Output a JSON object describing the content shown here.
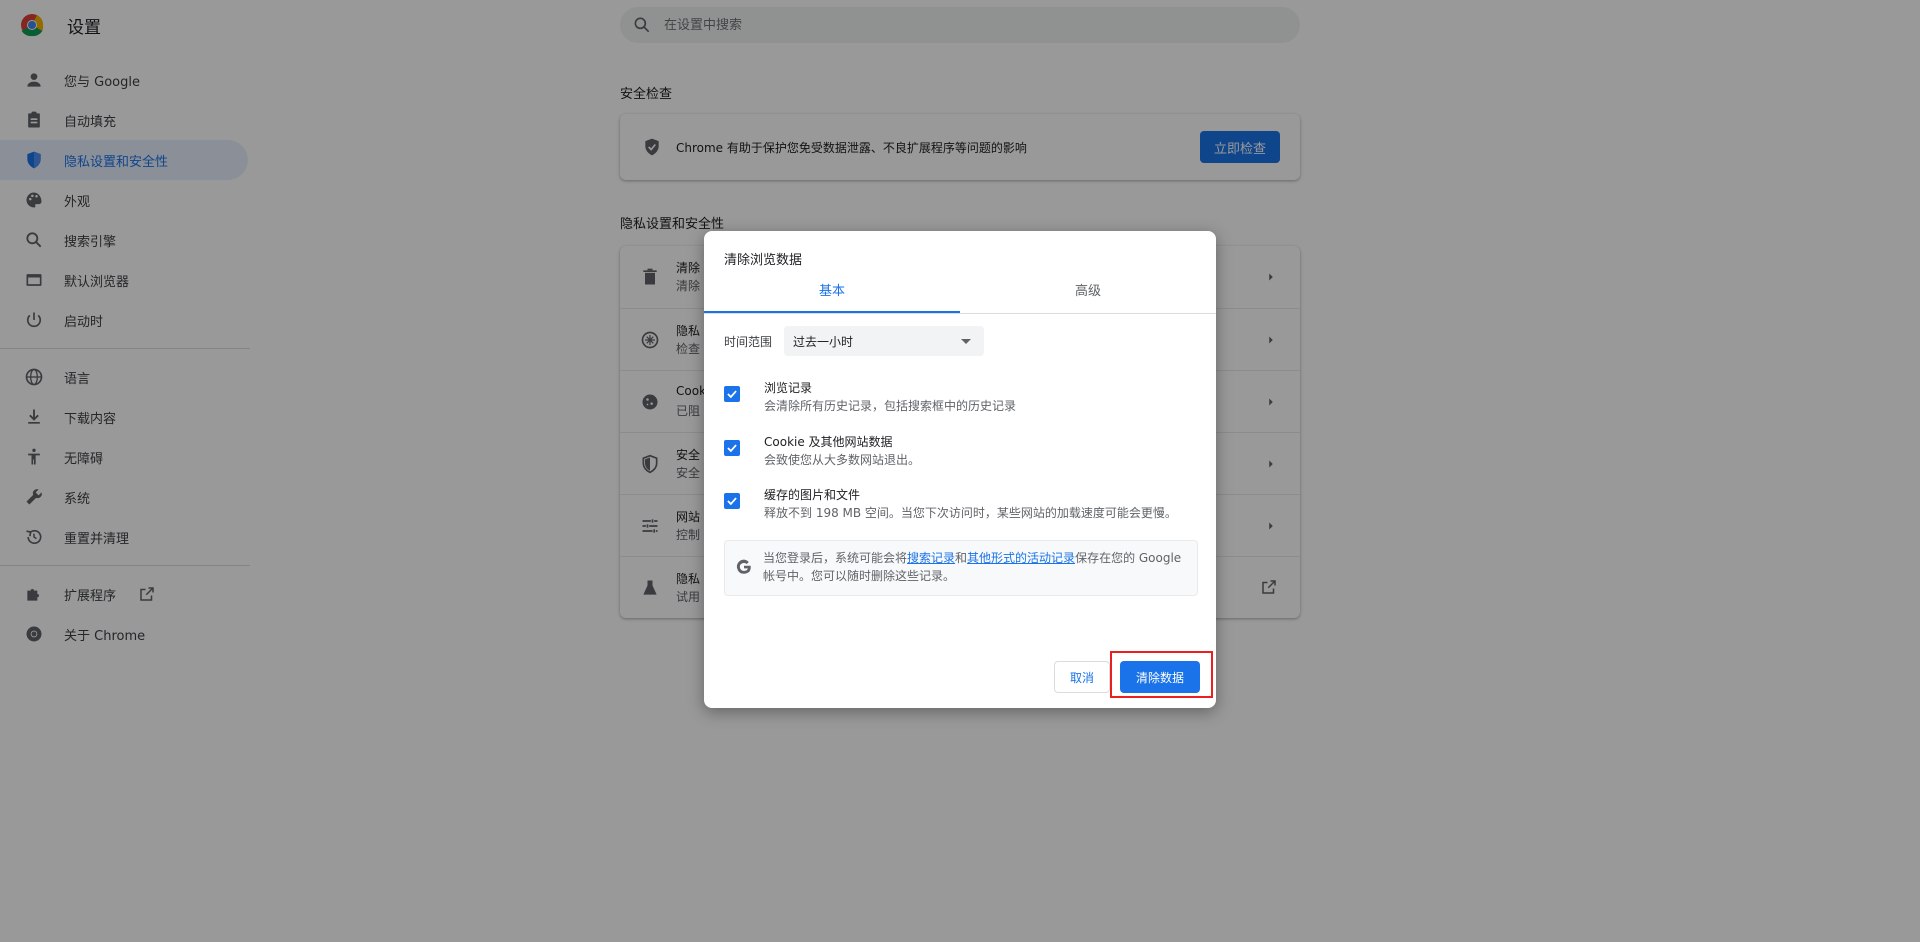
{
  "app": {
    "title": "设置",
    "icon": "chrome-logo"
  },
  "search": {
    "placeholder": "在设置中搜索",
    "value": "",
    "icon": "search-icon"
  },
  "sidebar": {
    "items": [
      {
        "label": "您与 Google",
        "icon": "person-icon",
        "active": false
      },
      {
        "label": "自动填充",
        "icon": "clipboard-icon",
        "active": false
      },
      {
        "label": "隐私设置和安全性",
        "icon": "shield-icon",
        "active": true
      },
      {
        "label": "外观",
        "icon": "palette-icon",
        "active": false
      },
      {
        "label": "搜索引擎",
        "icon": "search-icon",
        "active": false
      },
      {
        "label": "默认浏览器",
        "icon": "browser-icon",
        "active": false
      },
      {
        "label": "启动时",
        "icon": "power-icon",
        "active": false
      },
      {
        "label": "语言",
        "icon": "globe-icon",
        "active": false
      },
      {
        "label": "下载内容",
        "icon": "download-icon",
        "active": false
      },
      {
        "label": "无障碍",
        "icon": "accessibility-icon",
        "active": false
      },
      {
        "label": "系统",
        "icon": "wrench-icon",
        "active": false
      },
      {
        "label": "重置并清理",
        "icon": "restore-icon",
        "active": false
      },
      {
        "label": "扩展程序",
        "icon": "puzzle-icon",
        "active": false
      },
      {
        "label": "关于 Chrome",
        "icon": "chrome-icon",
        "active": false
      }
    ]
  },
  "safety_check": {
    "section_title": "安全检查",
    "text": "Chrome 有助于保护您免受数据泄露、不良扩展程序等问题的影响",
    "button": "立即检查"
  },
  "privacy": {
    "section_title": "隐私设置和安全性",
    "rows": [
      {
        "title": "清除",
        "subtitle": "清除",
        "icon": "trash-icon"
      },
      {
        "title": "隐私",
        "subtitle": "检查",
        "icon": "privacy-guide-icon"
      },
      {
        "title": "Cook",
        "subtitle": "已阻",
        "icon": "cookie-icon"
      },
      {
        "title": "安全",
        "subtitle": "安全",
        "icon": "security-shield-icon"
      },
      {
        "title": "网站",
        "subtitle": "控制",
        "icon": "tune-icon"
      },
      {
        "title": "隐私",
        "subtitle": "试用",
        "icon": "flask-icon"
      }
    ]
  },
  "dialog": {
    "title": "清除浏览数据",
    "tabs": [
      "基本",
      "高级"
    ],
    "active_tab": "基本",
    "time_range_label": "时间范围",
    "time_range_value": "过去一小时",
    "options": [
      {
        "title": "浏览记录",
        "subtitle": "会清除所有历史记录，包括搜索框中的历史记录",
        "checked": true
      },
      {
        "title": "Cookie 及其他网站数据",
        "subtitle": "会致使您从大多数网站退出。",
        "checked": true
      },
      {
        "title": "缓存的图片和文件",
        "subtitle": "释放不到 198 MB 空间。当您下次访问时，某些网站的加载速度可能会更慢。",
        "checked": true
      }
    ],
    "google_note": {
      "prefix": "当您登录后，系统可能会将",
      "link1": "搜索记录",
      "middle": "和",
      "link2": "其他形式的活动记录",
      "suffix": "保存在您的 Google 帐号中。您可以随时删除这些记录。"
    },
    "cancel": "取消",
    "confirm": "清除数据"
  },
  "colors": {
    "accent": "#1a73e8",
    "highlight": "#e8201f",
    "active_nav_bg": "#e8f0fe"
  }
}
